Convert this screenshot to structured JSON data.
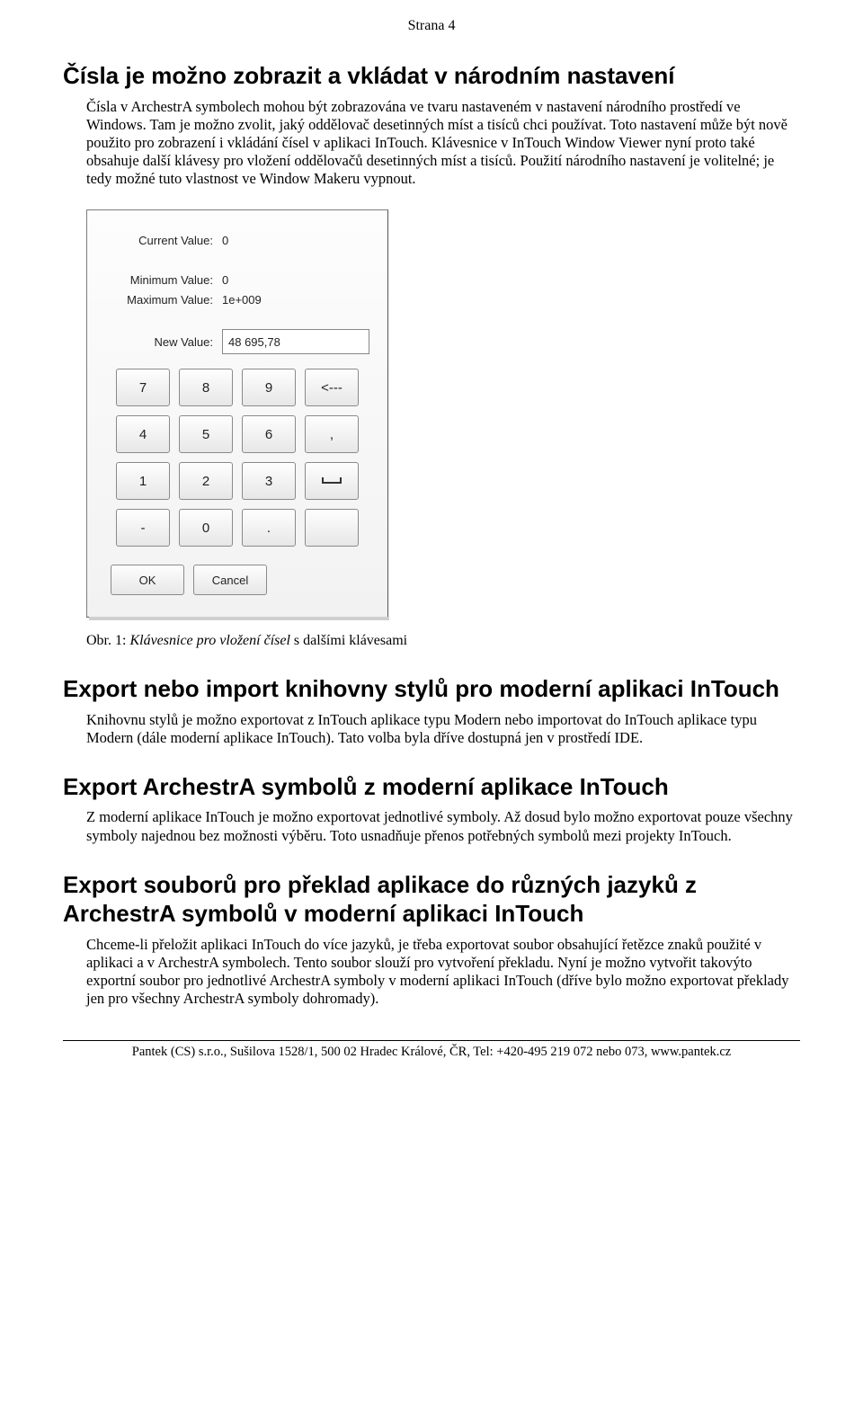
{
  "page_header": "Strana 4",
  "section1": {
    "title": "Čísla je možno zobrazit a vkládat v národním nastavení",
    "body": "Čísla v ArchestrA symbolech mohou být zobrazována ve tvaru nastaveném v nastavení národního prostředí ve Windows. Tam je možno zvolit, jaký oddělovač desetinných míst a tisíců chci používat. Toto nastavení může být nově použito pro zobrazení i vkládání čísel v aplikaci InTouch. Klávesnice v InTouch Window Viewer nyní proto také obsahuje další klávesy pro vložení oddělovačů desetinných míst a tisíců. Použití národního nastavení je volitelné; je tedy možné tuto vlastnost ve Window Makeru vypnout."
  },
  "keypad": {
    "labels": {
      "current_value": "Current Value:",
      "minimum_value": "Minimum Value:",
      "maximum_value": "Maximum Value:",
      "new_value": "New Value:",
      "ok": "OK",
      "cancel": "Cancel"
    },
    "values": {
      "current_value": "0",
      "minimum_value": "0",
      "maximum_value": "1e+009",
      "new_value": "48 695,78"
    },
    "keys": [
      "7",
      "8",
      "9",
      "<---",
      "4",
      "5",
      "6",
      ",",
      "1",
      "2",
      "3",
      "␣",
      "-",
      "0",
      ".",
      ""
    ]
  },
  "caption": {
    "prefix": "Obr. 1:  ",
    "italic": "Klávesnice pro vložení čísel",
    "suffix": " s dalšími klávesami"
  },
  "section2": {
    "title": "Export nebo import knihovny stylů pro moderní aplikaci InTouch",
    "body": "Knihovnu stylů je možno exportovat z InTouch aplikace typu Modern nebo importovat do InTouch aplikace typu Modern (dále moderní aplikace InTouch). Tato volba byla dříve dostupná jen v prostředí IDE."
  },
  "section3": {
    "title": "Export ArchestrA symbolů z moderní aplikace InTouch",
    "body": "Z moderní aplikace InTouch je možno exportovat jednotlivé symboly. Až dosud bylo možno exportovat pouze všechny symboly najednou bez možnosti výběru. Toto usnadňuje přenos potřebných symbolů mezi projekty InTouch."
  },
  "section4": {
    "title": "Export souborů pro překlad aplikace do různých jazyků z ArchestrA symbolů v moderní aplikaci InTouch",
    "body": "Chceme-li přeložit aplikaci InTouch do více jazyků, je třeba exportovat soubor obsahující řetězce znaků použité v aplikaci a v ArchestrA symbolech. Tento soubor slouží pro vytvoření překladu. Nyní je možno vytvořit takovýto exportní soubor pro jednotlivé ArchestrA symboly v moderní aplikaci InTouch (dříve bylo možno exportovat překlady jen pro všechny ArchestrA symboly dohromady)."
  },
  "footer": "Pantek (CS) s.r.o., Sušilova 1528/1, 500 02 Hradec Králové, ČR, Tel: +420-495 219 072 nebo 073, www.pantek.cz"
}
